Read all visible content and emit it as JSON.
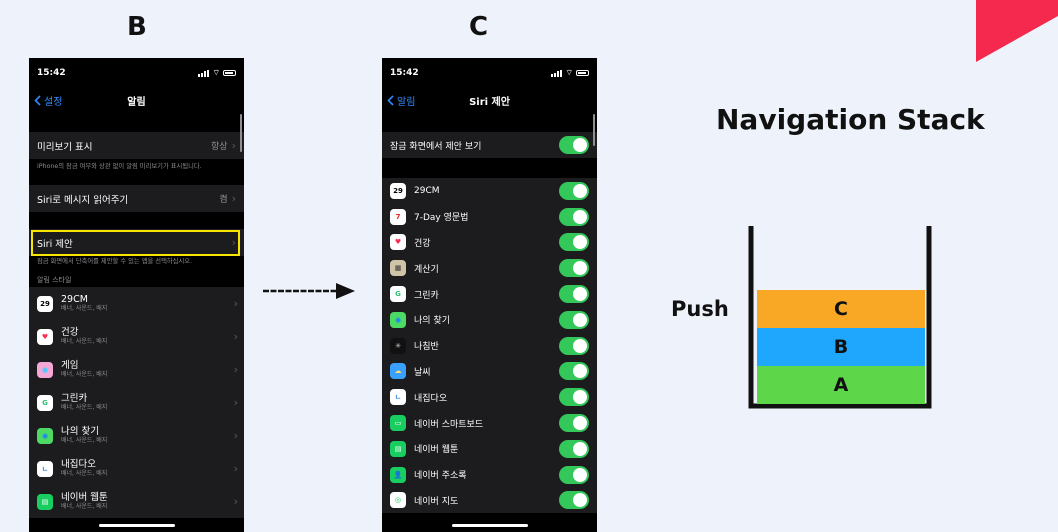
{
  "labels": {
    "left": "B",
    "right": "C"
  },
  "phoneB": {
    "time": "15:42",
    "back": "설정",
    "title": "알림",
    "preview": {
      "label": "미리보기 표시",
      "value": "항상"
    },
    "preview_footer": "iPhone의 잠금 여부와 상관 없이 알림 미리보기가 표시됩니다.",
    "siri_read": {
      "label": "Siri로 메시지 읽어주기",
      "value": "켬"
    },
    "siri_suggest": {
      "label": "Siri 제안"
    },
    "siri_footer": "잠금 화면에서 단축어를 제안할 수 있는 앱을 선택하십시오.",
    "section": "알림 스타일",
    "apps": [
      {
        "name": "29CM",
        "sub": "배너, 사운드, 배지",
        "icon": "29cm-icon",
        "glyph": "29",
        "bg": "#ffffff",
        "fg": "#000000"
      },
      {
        "name": "건강",
        "sub": "배너, 사운드, 배지",
        "icon": "health-icon",
        "glyph": "♥",
        "bg": "#ffffff",
        "fg": "#ff2d55"
      },
      {
        "name": "게임",
        "sub": "배너, 사운드, 배지",
        "icon": "game-center-icon",
        "glyph": "●",
        "bg": "#f4a8d8",
        "fg": "#5ac8fa"
      },
      {
        "name": "그린카",
        "sub": "배너, 사운드, 배지",
        "icon": "greencar-icon",
        "glyph": "G",
        "bg": "#ffffff",
        "fg": "#2fbf71"
      },
      {
        "name": "나의 찾기",
        "sub": "배너, 사운드, 배지",
        "icon": "find-my-icon",
        "glyph": "◉",
        "bg": "#4cd964",
        "fg": "#1c7cff"
      },
      {
        "name": "내집다오",
        "sub": "배너, 사운드, 배지",
        "icon": "naejipdao-icon",
        "glyph": "ㄴ",
        "bg": "#ffffff",
        "fg": "#2b7de0"
      },
      {
        "name": "네이버 웹툰",
        "sub": "배너, 사운드, 배지",
        "icon": "naver-webtoon-icon",
        "glyph": "▤",
        "bg": "#19ce60",
        "fg": "#ffffff"
      }
    ]
  },
  "phoneC": {
    "time": "15:42",
    "back": "알림",
    "title": "Siri 제안",
    "lock_label": "잠금 화면에서 제안 보기",
    "apps": [
      {
        "name": "29CM",
        "icon": "29cm-icon",
        "glyph": "29",
        "bg": "#ffffff",
        "fg": "#000000"
      },
      {
        "name": "7-Day 영문법",
        "icon": "7day-grammar-icon",
        "glyph": "7",
        "bg": "#ffffff",
        "fg": "#e02424"
      },
      {
        "name": "건강",
        "icon": "health-icon",
        "glyph": "♥",
        "bg": "#ffffff",
        "fg": "#ff2d55"
      },
      {
        "name": "계산기",
        "icon": "calculator-icon",
        "glyph": "▦",
        "bg": "#d0c4a8",
        "fg": "#333333"
      },
      {
        "name": "그린카",
        "icon": "greencar-icon",
        "glyph": "G",
        "bg": "#ffffff",
        "fg": "#2fbf71"
      },
      {
        "name": "나의 찾기",
        "icon": "find-my-icon",
        "glyph": "◉",
        "bg": "#4cd964",
        "fg": "#1c7cff"
      },
      {
        "name": "나침반",
        "icon": "compass-icon",
        "glyph": "✳",
        "bg": "#111111",
        "fg": "#cccccc"
      },
      {
        "name": "날씨",
        "icon": "weather-icon",
        "glyph": "☁",
        "bg": "#3aa0ff",
        "fg": "#ffe066"
      },
      {
        "name": "내집다오",
        "icon": "naejipdao-icon",
        "glyph": "ㄴ",
        "bg": "#ffffff",
        "fg": "#2b7de0"
      },
      {
        "name": "네이버 스마트보드",
        "icon": "naver-smartboard-icon",
        "glyph": "▭",
        "bg": "#19ce60",
        "fg": "#ffffff"
      },
      {
        "name": "네이버 웹툰",
        "icon": "naver-webtoon-icon",
        "glyph": "▤",
        "bg": "#19ce60",
        "fg": "#ffffff"
      },
      {
        "name": "네이버 주소록",
        "icon": "naver-contacts-icon",
        "glyph": "👤",
        "bg": "#19ce60",
        "fg": "#ffffff"
      },
      {
        "name": "네이버 지도",
        "icon": "naver-map-icon",
        "glyph": "◎",
        "bg": "#ffffff",
        "fg": "#19ce60"
      }
    ]
  },
  "stack": {
    "title": "Navigation Stack",
    "push": "Push",
    "blocks": [
      {
        "label": "C",
        "color": "#f9a825"
      },
      {
        "label": "B",
        "color": "#1ea7fd"
      },
      {
        "label": "A",
        "color": "#5ed64a"
      }
    ]
  },
  "accent": "#f5284d"
}
